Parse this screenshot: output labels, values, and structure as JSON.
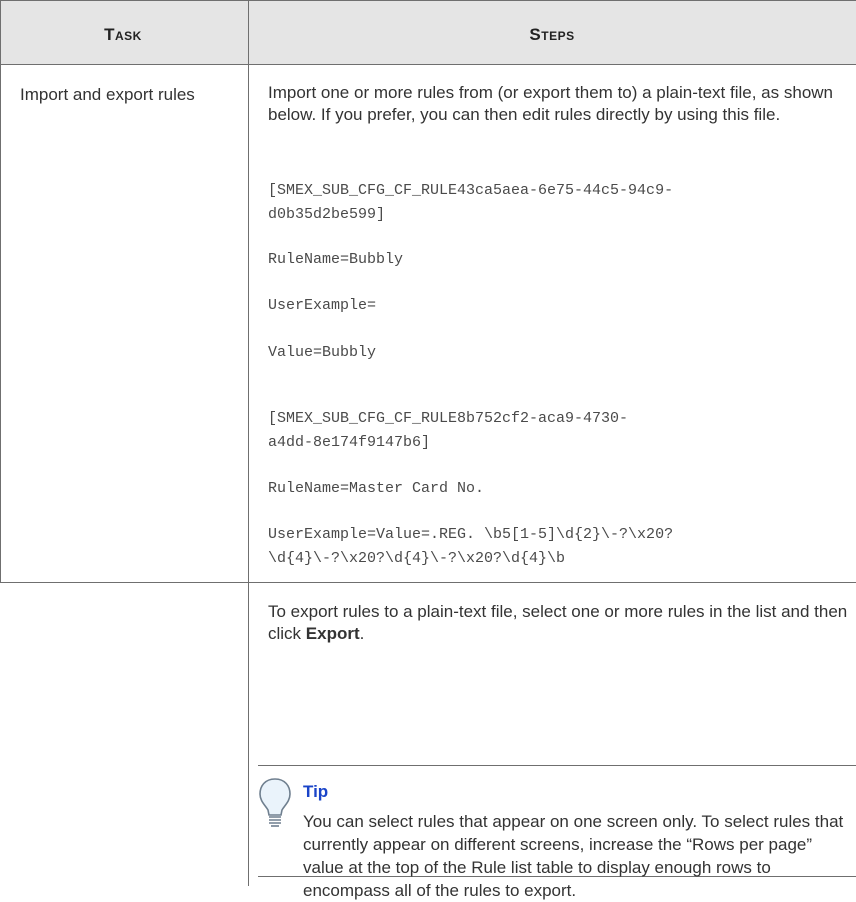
{
  "table": {
    "headers": {
      "task": "Task",
      "steps": "Steps"
    },
    "row1": {
      "task": "Import and export rules",
      "intro": "Import one or more rules from (or export them to) a plain-text file, as shown below. If you prefer, you can then edit rules directly by using this file.",
      "code_lines": [
        "[SMEX_SUB_CFG_CF_RULE43ca5aea-6e75-44c5-94c9-",
        "d0b35d2be599]",
        "RuleName=Bubbly",
        "UserExample=",
        "Value=Bubbly",
        "[SMEX_SUB_CFG_CF_RULE8b752cf2-aca9-4730-",
        "a4dd-8e174f9147b6]",
        "RuleName=Master Card No.",
        "UserExample=Value=.REG. \\b5[1-5]\\d{2}\\-?\\x20?",
        "\\d{4}\\-?\\x20?\\d{4}\\-?\\x20?\\d{4}\\b"
      ]
    },
    "row2": {
      "text_before": "To export rules to a plain-text file, select one or more rules in the list and then click ",
      "bold_word": "Export",
      "text_after": ".",
      "tip": {
        "icon": "lightbulb-icon",
        "title": "Tip",
        "body": "You can select rules that appear on one screen only. To select rules that currently appear on different screens, increase the “Rows per page” value at the top of the Rule list table to display enough rows to encompass all of the rules to export."
      }
    }
  },
  "colors": {
    "header_bg": "#e5e5e5",
    "rule": "#6f6f6f",
    "tip_title": "#1a44c8"
  }
}
